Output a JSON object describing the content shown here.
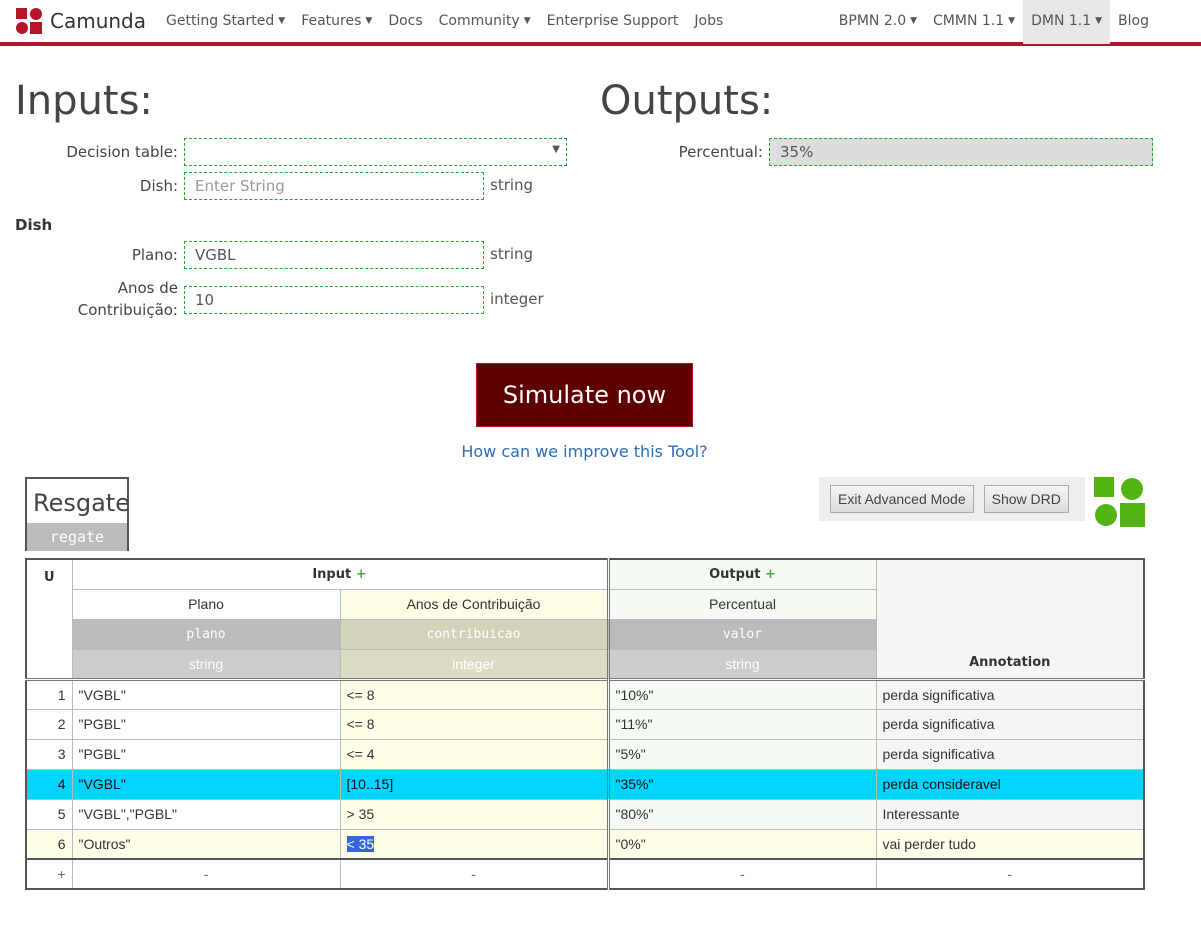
{
  "nav": {
    "brand": "Camunda",
    "left": [
      {
        "label": "Getting Started",
        "caret": true
      },
      {
        "label": "Features",
        "caret": true
      },
      {
        "label": "Docs",
        "caret": false
      },
      {
        "label": "Community",
        "caret": true
      },
      {
        "label": "Enterprise Support",
        "caret": false
      },
      {
        "label": "Jobs",
        "caret": false
      }
    ],
    "right": [
      {
        "label": "BPMN 2.0",
        "caret": true
      },
      {
        "label": "CMMN 1.1",
        "caret": true
      },
      {
        "label": "DMN 1.1",
        "caret": true,
        "active": true
      },
      {
        "label": "Blog",
        "caret": false
      }
    ]
  },
  "inputs": {
    "title": "Inputs:",
    "decision_label": "Decision table:",
    "decision_value": "",
    "dish_label": "Dish:",
    "dish_placeholder": "Enter String",
    "dish_type": "string",
    "section": "Dish",
    "plano_label": "Plano:",
    "plano_value": "VGBL",
    "plano_type": "string",
    "anos_label1": "Anos de",
    "anos_label2": "Contribuição:",
    "anos_value": "10",
    "anos_type": "integer"
  },
  "outputs": {
    "title": "Outputs:",
    "label": "Percentual:",
    "value": "35%"
  },
  "simulate": "Simulate now",
  "improve_link": "How can we improve this Tool?",
  "table": {
    "name": "Resgate",
    "id": "regate",
    "exit_btn": "Exit Advanced Mode",
    "drd_btn": "Show DRD",
    "hit_policy": "U",
    "input_header": "Input",
    "output_header": "Output",
    "annotation_header": "Annotation",
    "columns": [
      {
        "label": "Plano",
        "var": "plano",
        "type": "string"
      },
      {
        "label": "Anos de Contribuição",
        "var": "contribuicao",
        "type": "integer"
      },
      {
        "label": "Percentual",
        "var": "valor",
        "type": "string"
      }
    ],
    "rows": [
      {
        "n": "1",
        "c": [
          "\"VGBL\"",
          "<= 8",
          "\"10%\"",
          "perda significativa"
        ]
      },
      {
        "n": "2",
        "c": [
          "\"PGBL\"",
          "<= 8",
          "\"11%\"",
          "perda significativa"
        ]
      },
      {
        "n": "3",
        "c": [
          "\"PGBL\"",
          "<= 4",
          "\"5%\"",
          "perda significativa"
        ]
      },
      {
        "n": "4",
        "c": [
          "\"VGBL\"",
          "[10..15]",
          "\"35%\"",
          "perda consideravel"
        ]
      },
      {
        "n": "5",
        "c": [
          "\"VGBL\",\"PGBL\"",
          "> 35",
          "\"80%\"",
          "Interessante"
        ]
      },
      {
        "n": "6",
        "c": [
          "\"Outros\"",
          "< 35",
          "\"0%\"",
          "vai perder tudo"
        ]
      }
    ],
    "add_row": "+",
    "empty": "-"
  },
  "colors": {
    "brand": "#b5152b",
    "simulate": "#5e0000",
    "selected_row": "#00d5ff",
    "logo_green": "#52b415"
  }
}
